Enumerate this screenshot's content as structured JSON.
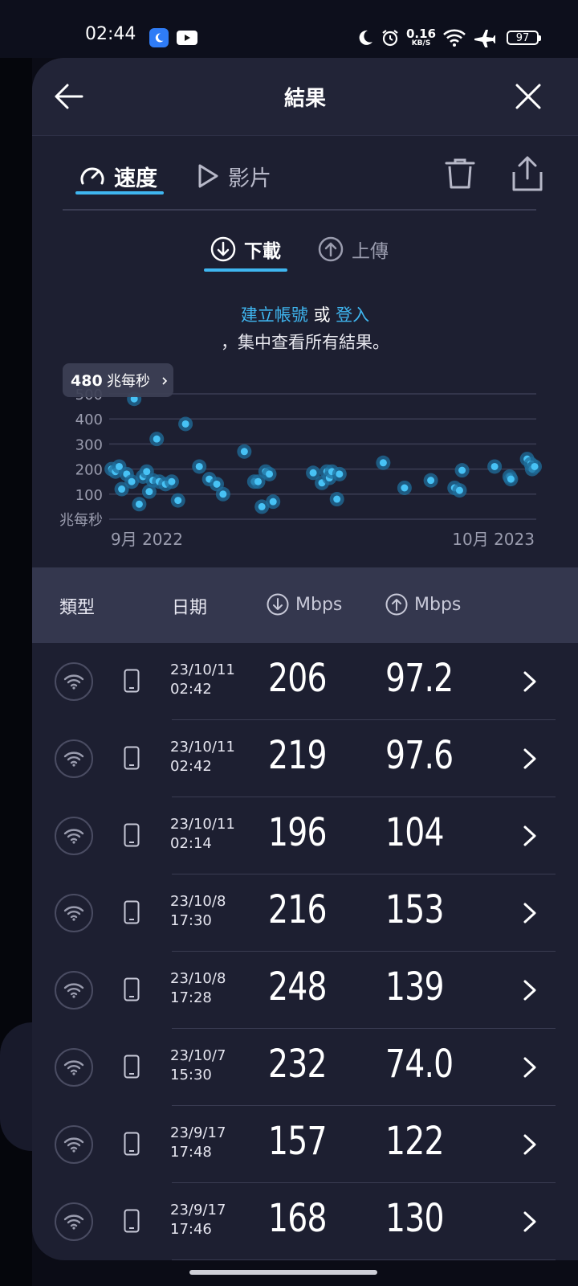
{
  "status_bar": {
    "time": "02:44",
    "net_speed_value": "0.16",
    "net_speed_unit": "KB/S",
    "battery": "97",
    "icons": [
      "moon-app-icon",
      "youtube-icon",
      "moon-icon",
      "alarm-icon",
      "wifi-icon",
      "airplane-icon",
      "battery-icon"
    ]
  },
  "header": {
    "title": "結果"
  },
  "tabs": {
    "speed": "速度",
    "video": "影片"
  },
  "direction": {
    "download": "下載",
    "upload": "上傳"
  },
  "prompt": {
    "create_account": "建立帳號",
    "or": " 或 ",
    "login": "登入",
    "line2": "，集中查看所有結果。"
  },
  "colors": {
    "accent": "#3fb6f0",
    "background": "#1d1f31",
    "header_row": "#34374e"
  },
  "chart_data": {
    "type": "scatter",
    "tooltip": {
      "value": "480",
      "unit": "兆每秒"
    },
    "y_ticks": [
      "500",
      "400",
      "300",
      "200",
      "100"
    ],
    "y_unit": "兆每秒",
    "x_tick_labels": [
      "9月 2022",
      "10月 2023"
    ],
    "ylim": [
      0,
      500
    ],
    "grid": true,
    "series": [
      {
        "x": [
          0.2,
          0.5,
          0.8,
          1.0,
          1.4,
          1.8,
          2.0,
          2.4,
          2.7,
          3.0,
          3.2,
          3.5,
          3.8,
          4.0,
          4.5,
          5.0,
          5.5,
          6.1,
          7.2,
          8.0,
          8.6,
          9.1,
          10.8,
          11.6,
          11.9,
          12.2,
          12.5,
          12.8,
          13.1,
          16.3,
          17.0,
          17.4,
          17.6,
          17.8,
          18.2,
          18.4,
          21.9,
          23.6,
          25.7,
          27.6,
          28.0,
          28.2,
          30.8,
          32.0,
          32.1,
          33.4,
          33.7,
          33.8,
          34.0
        ],
        "y": [
          200,
          190,
          210,
          120,
          180,
          150,
          480,
          60,
          170,
          190,
          110,
          155,
          320,
          150,
          140,
          150,
          75,
          380,
          210,
          160,
          140,
          100,
          270,
          150,
          150,
          50,
          190,
          180,
          70,
          185,
          145,
          190,
          165,
          190,
          80,
          180,
          225,
          125,
          155,
          125,
          115,
          195,
          210,
          170,
          160,
          240,
          220,
          200,
          210
        ]
      }
    ]
  },
  "table": {
    "headers": {
      "type": "類型",
      "date": "日期",
      "down_unit": "Mbps",
      "up_unit": "Mbps"
    },
    "rows": [
      {
        "date": "23/10/11",
        "time": "02:42",
        "down": "206",
        "up": "97.2"
      },
      {
        "date": "23/10/11",
        "time": "02:42",
        "down": "219",
        "up": "97.6"
      },
      {
        "date": "23/10/11",
        "time": "02:14",
        "down": "196",
        "up": "104"
      },
      {
        "date": "23/10/8",
        "time": "17:30",
        "down": "216",
        "up": "153"
      },
      {
        "date": "23/10/8",
        "time": "17:28",
        "down": "248",
        "up": "139"
      },
      {
        "date": "23/10/7",
        "time": "15:30",
        "down": "232",
        "up": "74.0"
      },
      {
        "date": "23/9/17",
        "time": "17:48",
        "down": "157",
        "up": "122"
      },
      {
        "date": "23/9/17",
        "time": "17:46",
        "down": "168",
        "up": "130"
      }
    ]
  }
}
